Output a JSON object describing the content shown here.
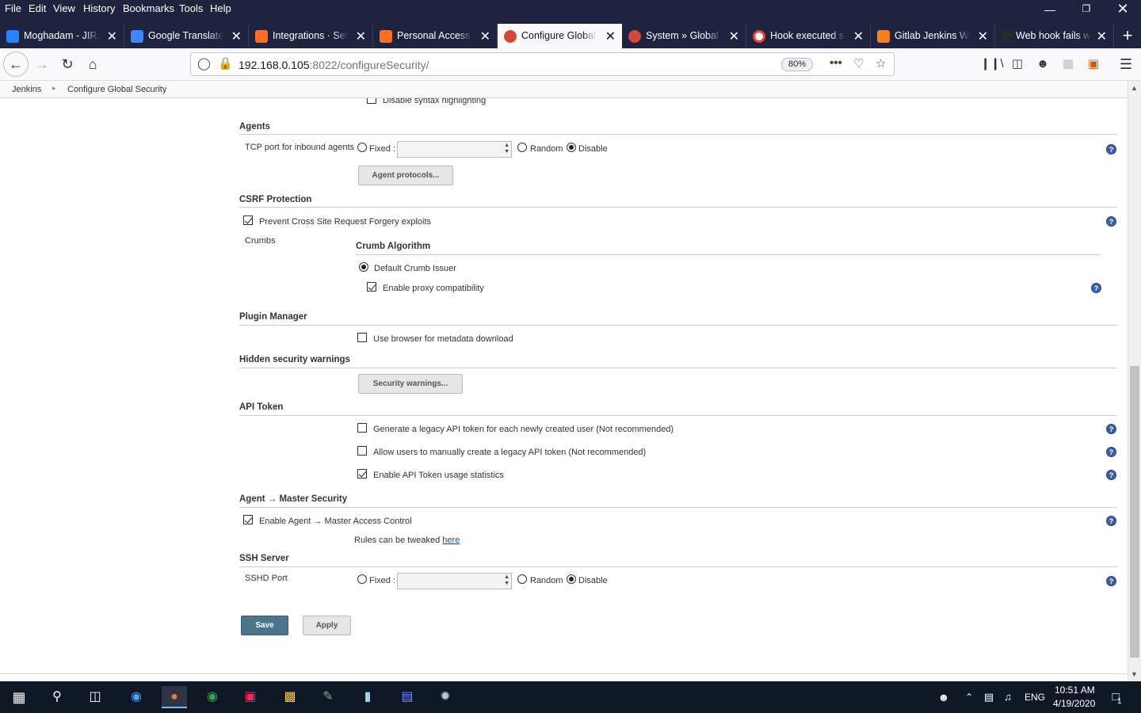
{
  "menubar": {
    "items": [
      "File",
      "Edit",
      "View",
      "History",
      "Bookmarks",
      "Tools",
      "Help"
    ]
  },
  "tabs": [
    {
      "label": "Moghadam - JIRA",
      "favicon_color": "#2684ff"
    },
    {
      "label": "Google Translate",
      "favicon_color": "#4285f4"
    },
    {
      "label": "Integrations · Settings",
      "favicon_color": "#fc6d26"
    },
    {
      "label": "Personal Access Tokens",
      "favicon_color": "#fc6d26"
    },
    {
      "label": "Configure Global Security",
      "favicon_color": "#d24939"
    },
    {
      "label": "System » Global credentials",
      "favicon_color": "#d24939"
    },
    {
      "label": "Hook executed successfully",
      "favicon_color": "#ea4335"
    },
    {
      "label": "Gitlab Jenkins Webhook",
      "favicon_color": "#f48024"
    },
    {
      "label": "Web hook fails when",
      "favicon_color": "#24292e"
    }
  ],
  "url": {
    "host": "192.168.0.105",
    "rest": ":8022/configureSecurity/",
    "zoom": "80%"
  },
  "breadcrumb": [
    "Jenkins",
    "Configure Global Security"
  ],
  "page": {
    "top_partial_checkbox": "Disable syntax highlighting",
    "agents": {
      "heading": "Agents",
      "tcp_label": "TCP port for inbound agents",
      "fixed": "Fixed :",
      "random": "Random",
      "disable": "Disable",
      "protocols_btn": "Agent protocols..."
    },
    "csrf": {
      "heading": "CSRF Protection",
      "prevent": "Prevent Cross Site Request Forgery exploits",
      "crumbs": "Crumbs",
      "crumb_algo": "Crumb Algorithm",
      "default_issuer": "Default Crumb Issuer",
      "proxy_compat": "Enable proxy compatibility"
    },
    "plugin": {
      "heading": "Plugin Manager",
      "browser_meta": "Use browser for metadata download"
    },
    "hidden": {
      "heading": "Hidden security warnings",
      "btn": "Security warnings..."
    },
    "api": {
      "heading": "API Token",
      "legacy_new": "Generate a legacy API token for each newly created user (Not recommended)",
      "legacy_manual": "Allow users to manually create a legacy API token (Not recommended)",
      "usage_stats": "Enable API Token usage statistics"
    },
    "agent_master": {
      "heading": "Agent → Master Security",
      "enable": "Enable Agent → Master Access Control",
      "rules_prefix": "Rules can be tweaked",
      "rules_link": "here"
    },
    "ssh": {
      "heading": "SSH Server",
      "port_label": "SSHD Port",
      "fixed": "Fixed :",
      "random": "Random",
      "disable": "Disable"
    },
    "save": "Save",
    "apply": "Apply"
  },
  "taskbar": {
    "lang": "ENG",
    "time": "10:51 AM",
    "date": "4/19/2020",
    "notif_count": "1"
  }
}
